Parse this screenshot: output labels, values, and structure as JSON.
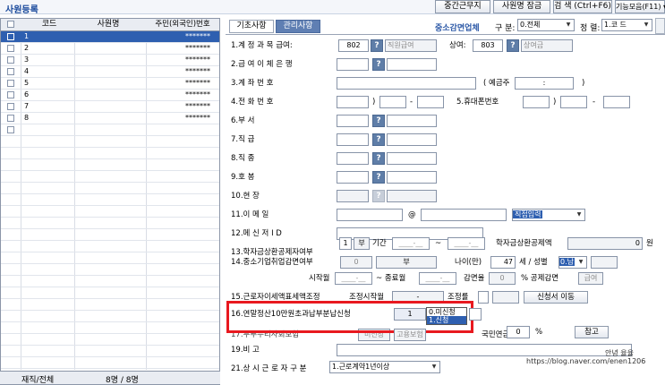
{
  "app_title": "사원등록",
  "toolbar": [
    "중간근무지",
    "사원명 잠금",
    "검 색 (Ctrl+F6)",
    "기능모음(F11) ▾"
  ],
  "left": {
    "columns": [
      "코드",
      "사원명",
      "주민(외국인)번호"
    ],
    "rows": [
      {
        "code": "1",
        "name": "",
        "rrn": "*******"
      },
      {
        "code": "2",
        "name": "",
        "rrn": "*******"
      },
      {
        "code": "3",
        "name": "",
        "rrn": "*******"
      },
      {
        "code": "4",
        "name": "",
        "rrn": "*******"
      },
      {
        "code": "5",
        "name": "",
        "rrn": "*******"
      },
      {
        "code": "6",
        "name": "",
        "rrn": "*******"
      },
      {
        "code": "7",
        "name": "",
        "rrn": "*******"
      },
      {
        "code": "8",
        "name": "",
        "rrn": "*******"
      }
    ],
    "footer_label": "재직/전체",
    "footer_count": "8명 / 8명"
  },
  "tabs": [
    "기초사항",
    "관리사항"
  ],
  "sme_label": "중소감면업체",
  "division_label": "구 분:",
  "division_value": "0.전체",
  "sort_label": "정 렬:",
  "sort_value": "1.코 드",
  "form": {
    "r1_label": "1.계 정 과 목 급여:",
    "r1_salary_code": "802",
    "r1_salary_name": "직원급여",
    "r1_bonus_label": "상여:",
    "r1_bonus_code": "803",
    "r1_bonus_name": "상여금",
    "r2_label": "2.급 여 이 체 은 행",
    "r3_label": "3.계 좌 번 호",
    "r3_holder_label": "( 예금주",
    "r3_holder_colon": ":",
    "r3_close": ")",
    "r4_label": "4.전 화 번 호",
    "r4_paren": ")",
    "r4_dash": "-",
    "r5_label": "5.휴대폰번호",
    "r5_paren": ")",
    "r5_dash": "-",
    "r6_label": "6.부 서",
    "r7_label": "7.직 급",
    "r8_label": "8.직 종",
    "r9_label": "9.호 봉",
    "r10_label": "10.현 장",
    "r11_label": "11.이 메 일",
    "r11_at": "@",
    "r11_domain": "직접입력",
    "r12_label": "12.메 신 저 I D",
    "r13_label": "13.학자금상환공제자여부",
    "r13_value": "1",
    "r13_sub": "부",
    "r13_period": "기간",
    "r13_from": "____-__",
    "r13_tilde": "~",
    "r13_to": "____-__",
    "r13_amt_label": "학자금상환공제액",
    "r13_amt": "0",
    "r13_won": "원",
    "r14_label": "14.중소기업취업감면여부",
    "r14_value": "0",
    "r14_sub": "부",
    "r14_age_label": "나이(만)",
    "r14_age": "47",
    "r14_gender_label": "세 / 성별",
    "r14_gender": "0.남",
    "r14b_start_label": "시작월",
    "r14b_start": "____-__",
    "r14b_end_label": "~ 종료월",
    "r14b_end": "____-__",
    "r14b_rate_label": "감면율",
    "r14b_rate": "0",
    "r14b_limit_label": "% 공제감면",
    "r14b_limit": "급여",
    "r15_label": "15.근로자이세액표세액조정",
    "r15_start_label": "조정시작월",
    "r15_start": "-",
    "r15_rate_label": "조정률",
    "r15_btn": "신청서 이동",
    "r16_label": "16.연말정산10만원초과납부분납신청",
    "r16_value": "1",
    "r16_opt0": "0.미신청",
    "r16_opt1": "1.신청",
    "r17_label": "17.두루누리사회보험",
    "r17_a": "미신청",
    "r17_b": "고용보험",
    "r17_c": "국민연금",
    "r17_rate": "0",
    "r17_pct": "%",
    "r17_btn": "참고",
    "r19_label": "19.비 고",
    "r21_label": "21.상 시 근 로 자 구 분",
    "r21_value": "1.근로계약1년이상"
  },
  "watermark_name": "안녕 율율",
  "watermark_url": "https://blog.naver.com/enen1206"
}
